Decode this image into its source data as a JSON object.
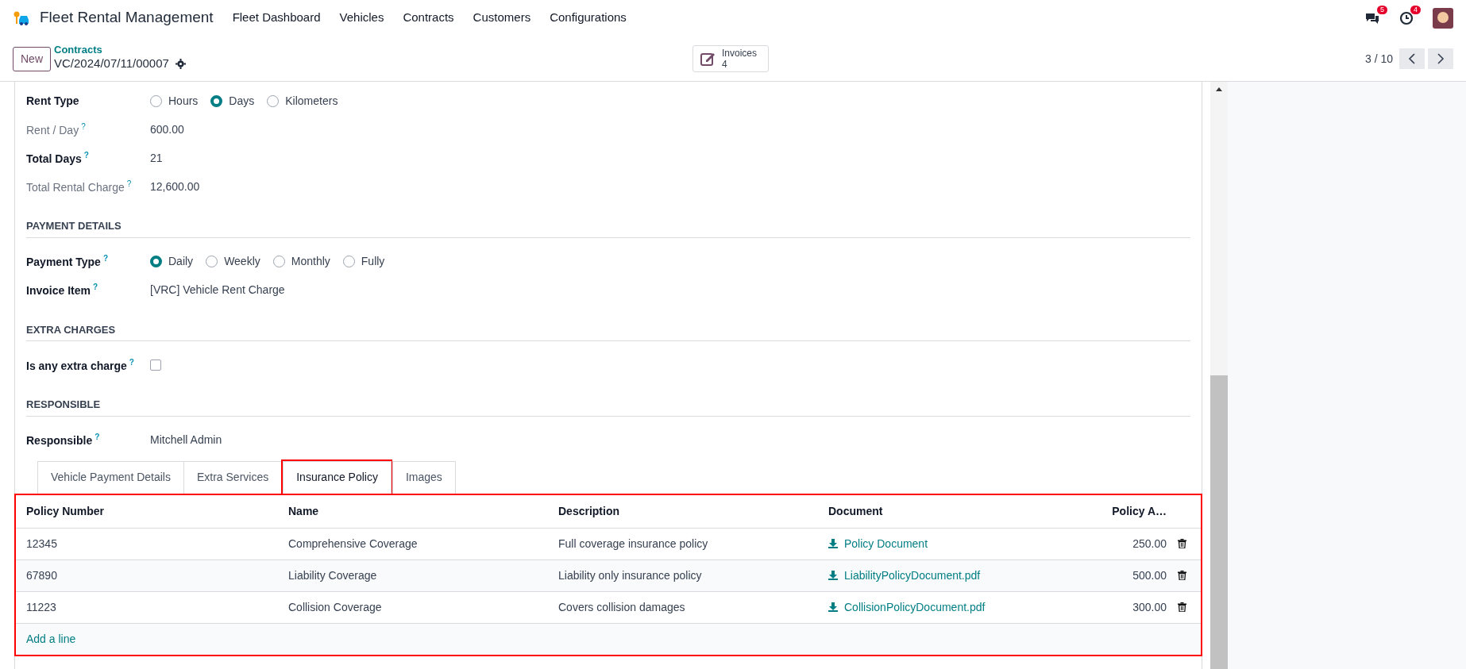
{
  "navbar": {
    "app_name": "Fleet Rental Management",
    "menu": [
      "Fleet Dashboard",
      "Vehicles",
      "Contracts",
      "Customers",
      "Configurations"
    ],
    "messages_count": "5",
    "activities_count": "4"
  },
  "control_panel": {
    "new_button": "New",
    "breadcrumb": "Contracts",
    "record_name": "VC/2024/07/11/00007",
    "smart_button": {
      "label": "Invoices",
      "count": "4"
    },
    "pager": "3 / 10"
  },
  "sections": [
    {
      "fields": [
        {
          "kind": "radio",
          "label": "Rent Type",
          "readonly": false,
          "options": [
            {
              "label": "Hours",
              "selected": false
            },
            {
              "label": "Days",
              "selected": true
            },
            {
              "label": "Kilometers",
              "selected": false
            }
          ]
        },
        {
          "kind": "text",
          "label": "Rent / Day",
          "help": "?",
          "readonly": true,
          "value": "600.00"
        },
        {
          "kind": "text",
          "label": "Total Days",
          "help": "?",
          "readonly": false,
          "value": "21"
        },
        {
          "kind": "text",
          "label": "Total Rental Charge",
          "help": "?",
          "readonly": true,
          "value": "12,600.00"
        }
      ]
    },
    {
      "title": "PAYMENT DETAILS",
      "fields": [
        {
          "kind": "radio",
          "label": "Payment Type",
          "help": "?",
          "readonly": false,
          "options": [
            {
              "label": "Daily",
              "selected": true
            },
            {
              "label": "Weekly",
              "selected": false
            },
            {
              "label": "Monthly",
              "selected": false
            },
            {
              "label": "Fully",
              "selected": false
            }
          ]
        },
        {
          "kind": "text",
          "label": "Invoice Item",
          "help": "?",
          "readonly": false,
          "value": "[VRC] Vehicle Rent Charge"
        }
      ]
    },
    {
      "title": "EXTRA CHARGES",
      "fields": [
        {
          "kind": "checkbox",
          "label": "Is any extra charge",
          "help": "?",
          "readonly": false,
          "checked": false
        }
      ]
    },
    {
      "title": "RESPONSIBLE",
      "fields": [
        {
          "kind": "text",
          "label": "Responsible",
          "help": "?",
          "readonly": false,
          "value": "Mitchell Admin"
        }
      ]
    }
  ],
  "notebook": {
    "tabs": [
      {
        "label": "Vehicle Payment Details",
        "selected": false,
        "highlighted": false
      },
      {
        "label": "Extra Services",
        "selected": false,
        "highlighted": false
      },
      {
        "label": "Insurance Policy",
        "selected": true,
        "highlighted": true
      },
      {
        "label": "Images",
        "selected": false,
        "highlighted": false
      }
    ],
    "table": {
      "highlighted": true,
      "columns": [
        {
          "label": "Policy Number",
          "kind": "text"
        },
        {
          "label": "Name",
          "kind": "text"
        },
        {
          "label": "Description",
          "kind": "text"
        },
        {
          "label": "Document",
          "kind": "file"
        },
        {
          "label": "Policy A…",
          "kind": "amount"
        }
      ],
      "rows": [
        [
          "12345",
          "Comprehensive Coverage",
          "Full coverage insurance policy",
          "Policy Document",
          "250.00"
        ],
        [
          "67890",
          "Liability Coverage",
          "Liability only insurance policy",
          "LiabilityPolicyDocument.pdf",
          "500.00"
        ],
        [
          "11223",
          "Collision Coverage",
          "Covers collision damages",
          "CollisionPolicyDocument.pdf",
          "300.00"
        ]
      ],
      "add_line": "Add a line"
    }
  }
}
